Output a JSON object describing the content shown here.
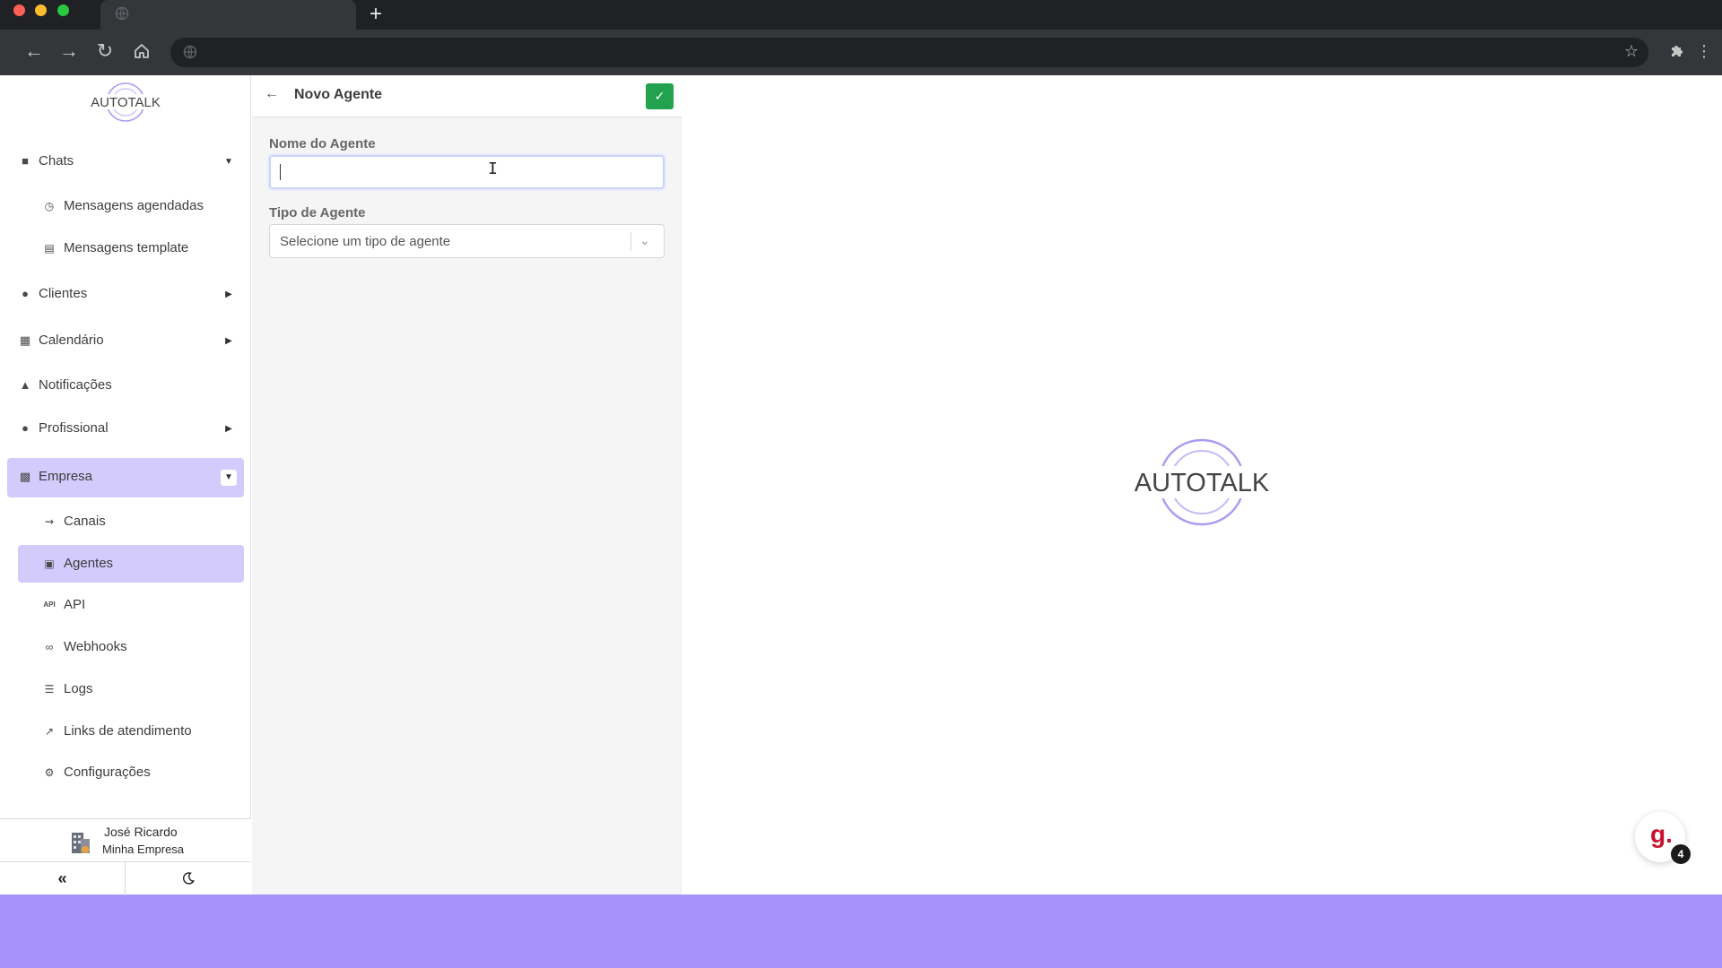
{
  "browser": {
    "new_tab": "+"
  },
  "brand": {
    "name": "AUTOTALK",
    "accent": "#d2cbfb",
    "footer_bg": "#a592fb",
    "save_color": "#22a24e"
  },
  "sidebar": {
    "items": [
      {
        "label": "Chats",
        "icon": "chat-icon"
      },
      {
        "label": "Mensagens agendadas",
        "icon": "clock-icon"
      },
      {
        "label": "Mensagens template",
        "icon": "template-icon"
      },
      {
        "label": "Clientes",
        "icon": "users-icon"
      },
      {
        "label": "Calendário",
        "icon": "calendar-icon"
      },
      {
        "label": "Notificações",
        "icon": "bell-icon"
      },
      {
        "label": "Profissional",
        "icon": "user-cog-icon"
      },
      {
        "label": "Empresa",
        "icon": "building-icon"
      },
      {
        "label": "Canais",
        "icon": "channels-icon"
      },
      {
        "label": "Agentes",
        "icon": "robot-icon"
      },
      {
        "label": "API",
        "icon": "api-icon"
      },
      {
        "label": "Webhooks",
        "icon": "webhook-icon"
      },
      {
        "label": "Logs",
        "icon": "list-icon"
      },
      {
        "label": "Links de atendimento",
        "icon": "external-link-icon"
      },
      {
        "label": "Configurações",
        "icon": "gear-icon"
      }
    ],
    "user": {
      "name": "José Ricardo",
      "company": "Minha Empresa"
    }
  },
  "form": {
    "title": "Novo Agente",
    "name_label": "Nome do Agente",
    "name_value": "",
    "type_label": "Tipo de Agente",
    "type_placeholder": "Selecione um tipo de agente"
  },
  "help": {
    "letter": "g.",
    "badge_count": "4"
  }
}
